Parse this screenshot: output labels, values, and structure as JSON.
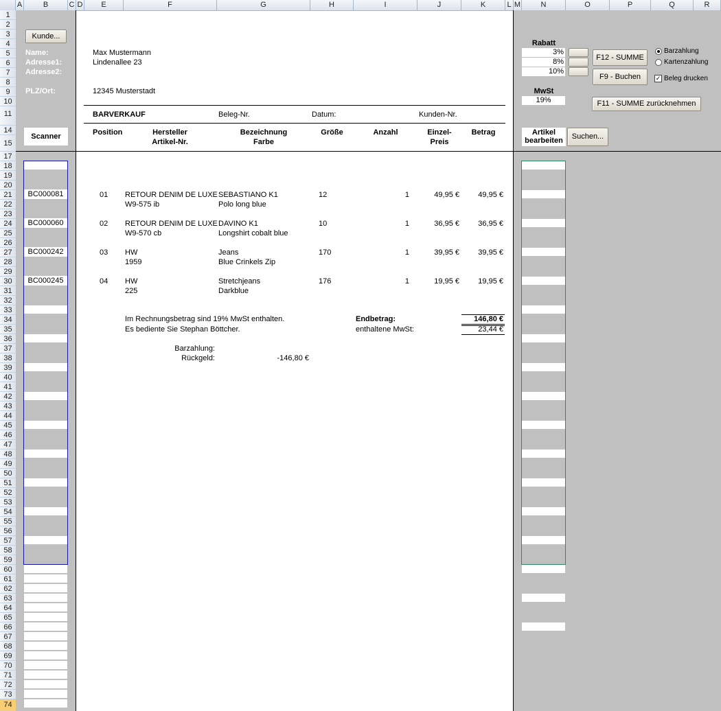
{
  "columns": [
    "A",
    "B",
    "C",
    "D",
    "E",
    "F",
    "G",
    "H",
    "I",
    "J",
    "K",
    "L",
    "M",
    "N",
    "O",
    "P",
    "Q",
    "R"
  ],
  "rows": [
    "1",
    "2",
    "3",
    "4",
    "5",
    "6",
    "7",
    "8",
    "9",
    "10",
    "11",
    "14",
    "15",
    "17",
    "18",
    "19",
    "20",
    "21",
    "22",
    "23",
    "24",
    "25",
    "26",
    "27",
    "28",
    "29",
    "30",
    "31",
    "32",
    "33",
    "34",
    "35",
    "36",
    "37",
    "38",
    "39",
    "40",
    "41",
    "42",
    "43",
    "44",
    "45",
    "46",
    "47",
    "48",
    "49",
    "50",
    "51",
    "52",
    "53",
    "54",
    "55",
    "56",
    "57",
    "58",
    "59",
    "60",
    "61",
    "62",
    "63",
    "64",
    "65",
    "66",
    "67",
    "68",
    "69",
    "70",
    "71",
    "72",
    "73",
    "74"
  ],
  "left_panel": {
    "kunde_button": "Kunde...",
    "name_label": "Name:",
    "adresse1_label": "Adresse1:",
    "adresse2_label": "Adresse2:",
    "plz_label": "PLZ/Ort:",
    "scanner_label": "Scanner",
    "scanner_codes": [
      "BC000081",
      "BC000060",
      "BC000242",
      "BC000245"
    ]
  },
  "customer": {
    "name": "Max Mustermann",
    "adresse1": "Lindenallee 23",
    "plz_ort": "12345 Musterstadt"
  },
  "receipt_header": {
    "barverkauf": "BARVERKAUF",
    "beleg_nr": "Beleg-Nr.",
    "datum": "Datum:",
    "kunden_nr": "Kunden-Nr."
  },
  "table_headers": {
    "position": "Position",
    "hersteller_1": "Hersteller",
    "hersteller_2": "Artikel-Nr.",
    "bezeichnung_1": "Bezeichnung",
    "bezeichnung_2": "Farbe",
    "groesse": "Größe",
    "anzahl": "Anzahl",
    "einzel_1": "Einzel-",
    "einzel_2": "Preis",
    "betrag": "Betrag"
  },
  "items": [
    {
      "pos": "01",
      "hersteller": "RETOUR DENIM DE LUXE",
      "artikel": "W9-575 ib",
      "bez": "SEBASTIANO K1",
      "farbe": "Polo long blue",
      "groesse": "12",
      "anzahl": "1",
      "einzel": "49,95 €",
      "betrag": "49,95 €"
    },
    {
      "pos": "02",
      "hersteller": "RETOUR DENIM DE LUXE",
      "artikel": "W9-570 cb",
      "bez": "DAVINO K1",
      "farbe": "Longshirt cobalt blue",
      "groesse": "10",
      "anzahl": "1",
      "einzel": "36,95 €",
      "betrag": "36,95 €"
    },
    {
      "pos": "03",
      "hersteller": "HW",
      "artikel": "1959",
      "bez": "Jeans",
      "farbe": "Blue Crinkels Zip",
      "groesse": "170",
      "anzahl": "1",
      "einzel": "39,95 €",
      "betrag": "39,95 €"
    },
    {
      "pos": "04",
      "hersteller": "HW",
      "artikel": "225",
      "bez": "Stretchjeans",
      "farbe": "Darkblue",
      "groesse": "176",
      "anzahl": "1",
      "einzel": "19,95 €",
      "betrag": "19,95 €"
    }
  ],
  "footer": {
    "mwst_note": "Im Rechnungsbetrag sind 19% MwSt enthalten.",
    "served_by": "Es bediente Sie Stephan Böttcher.",
    "endbetrag_label": "Endbetrag:",
    "endbetrag_value": "146,80 €",
    "mwst_label": "enthaltene MwSt:",
    "mwst_value": "23,44 €",
    "barzahlung_label": "Barzahlung:",
    "rueckgeld_label": "Rückgeld:",
    "rueckgeld_value": "-146,80 €"
  },
  "right_panel": {
    "rabatt_label": "Rabatt",
    "rabatt_values": [
      "3%",
      "8%",
      "10%"
    ],
    "mwst_label": "MwSt",
    "mwst_value": "19%",
    "f12_button": "F12 - SUMME",
    "f9_button": "F9 - Buchen",
    "f11_button": "F11 - SUMME zurücknehmen",
    "barzahlung_option": "Barzahlung",
    "kartenzahlung_option": "Kartenzahlung",
    "beleg_drucken": "Beleg drucken",
    "artikel_label_1": "Artikel",
    "artikel_label_2": "bearbeiten",
    "suchen_button": "Suchen..."
  }
}
